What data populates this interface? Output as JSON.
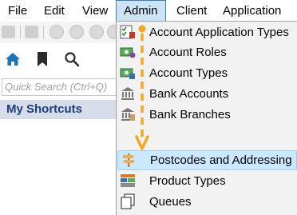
{
  "menubar": {
    "items": [
      "File",
      "Edit",
      "View",
      "Admin",
      "Client",
      "Application"
    ],
    "open_index": 3
  },
  "leftpanel": {
    "search_placeholder": "Quick Search (Ctrl+Q)",
    "shortcuts_title": "My Shortcuts"
  },
  "dropdown": {
    "items": [
      {
        "label": "Account Application Types",
        "icon": "checklist-icon"
      },
      {
        "label": "Account Roles",
        "icon": "money-role-icon"
      },
      {
        "label": "Account Types",
        "icon": "money-type-icon"
      },
      {
        "label": "Bank Accounts",
        "icon": "bank-icon"
      },
      {
        "label": "Bank Branches",
        "icon": "bank-branch-icon"
      },
      {
        "label": "Postcodes and Addressing",
        "icon": "signpost-icon"
      },
      {
        "label": "Product Types",
        "icon": "product-types-icon"
      },
      {
        "label": "Queues",
        "icon": "queues-icon"
      }
    ],
    "highlighted_index": 5
  },
  "colors": {
    "menu_open_bg": "#cce4f7",
    "highlight_bg": "#cce8ff",
    "annotation_arrow": "#f5a623",
    "shortcuts_text": "#1b3e7e",
    "home_icon": "#1e73be"
  }
}
